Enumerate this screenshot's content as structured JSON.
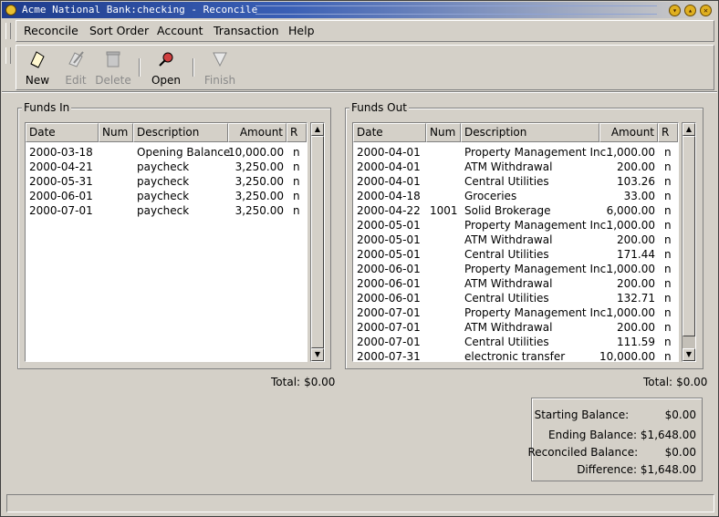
{
  "window": {
    "title": "Acme National Bank:checking - Reconcile"
  },
  "menu": {
    "items": [
      {
        "label": "Reconcile"
      },
      {
        "label": "Sort Order"
      },
      {
        "label": "Account"
      },
      {
        "label": "Transaction"
      },
      {
        "label": "Help"
      }
    ]
  },
  "toolbar": {
    "new_label": "New",
    "edit_label": "Edit",
    "delete_label": "Delete",
    "open_label": "Open",
    "finish_label": "Finish"
  },
  "funds_in": {
    "label": "Funds In",
    "columns": {
      "date": "Date",
      "num": "Num",
      "description": "Description",
      "amount": "Amount",
      "r": "R"
    },
    "rows": [
      {
        "date": "2000-03-18",
        "num": "",
        "description": "Opening Balance",
        "amount": "10,000.00",
        "r": "n"
      },
      {
        "date": "2000-04-21",
        "num": "",
        "description": "paycheck",
        "amount": "3,250.00",
        "r": "n"
      },
      {
        "date": "2000-05-31",
        "num": "",
        "description": "paycheck",
        "amount": "3,250.00",
        "r": "n"
      },
      {
        "date": "2000-06-01",
        "num": "",
        "description": "paycheck",
        "amount": "3,250.00",
        "r": "n"
      },
      {
        "date": "2000-07-01",
        "num": "",
        "description": "paycheck",
        "amount": "3,250.00",
        "r": "n"
      }
    ],
    "total_label": "Total:",
    "total_value": "$0.00"
  },
  "funds_out": {
    "label": "Funds Out",
    "columns": {
      "date": "Date",
      "num": "Num",
      "description": "Description",
      "amount": "Amount",
      "r": "R"
    },
    "rows": [
      {
        "date": "2000-04-01",
        "num": "",
        "description": "Property Management Inc.",
        "amount": "1,000.00",
        "r": "n"
      },
      {
        "date": "2000-04-01",
        "num": "",
        "description": "ATM Withdrawal",
        "amount": "200.00",
        "r": "n"
      },
      {
        "date": "2000-04-01",
        "num": "",
        "description": "Central Utilities",
        "amount": "103.26",
        "r": "n"
      },
      {
        "date": "2000-04-18",
        "num": "",
        "description": "Groceries",
        "amount": "33.00",
        "r": "n"
      },
      {
        "date": "2000-04-22",
        "num": "1001",
        "description": "Solid Brokerage",
        "amount": "6,000.00",
        "r": "n"
      },
      {
        "date": "2000-05-01",
        "num": "",
        "description": "Property Management Inc.",
        "amount": "1,000.00",
        "r": "n"
      },
      {
        "date": "2000-05-01",
        "num": "",
        "description": "ATM Withdrawal",
        "amount": "200.00",
        "r": "n"
      },
      {
        "date": "2000-05-01",
        "num": "",
        "description": "Central Utilities",
        "amount": "171.44",
        "r": "n"
      },
      {
        "date": "2000-06-01",
        "num": "",
        "description": "Property Management Inc.",
        "amount": "1,000.00",
        "r": "n"
      },
      {
        "date": "2000-06-01",
        "num": "",
        "description": "ATM Withdrawal",
        "amount": "200.00",
        "r": "n"
      },
      {
        "date": "2000-06-01",
        "num": "",
        "description": "Central Utilities",
        "amount": "132.71",
        "r": "n"
      },
      {
        "date": "2000-07-01",
        "num": "",
        "description": "Property Management Inc.",
        "amount": "1,000.00",
        "r": "n"
      },
      {
        "date": "2000-07-01",
        "num": "",
        "description": "ATM Withdrawal",
        "amount": "200.00",
        "r": "n"
      },
      {
        "date": "2000-07-01",
        "num": "",
        "description": "Central Utilities",
        "amount": "111.59",
        "r": "n"
      },
      {
        "date": "2000-07-31",
        "num": "",
        "description": "electronic transfer",
        "amount": "10,000.00",
        "r": "n"
      }
    ],
    "total_label": "Total:",
    "total_value": "$0.00"
  },
  "summary": {
    "starting_label": "Starting Balance:",
    "starting_value": "$0.00",
    "ending_label": "Ending Balance:",
    "ending_value": "$1,648.00",
    "reconciled_label": "Reconciled Balance:",
    "reconciled_value": "$0.00",
    "difference_label": "Difference:",
    "difference_value": "$1,648.00"
  },
  "status": {
    "text": ""
  }
}
